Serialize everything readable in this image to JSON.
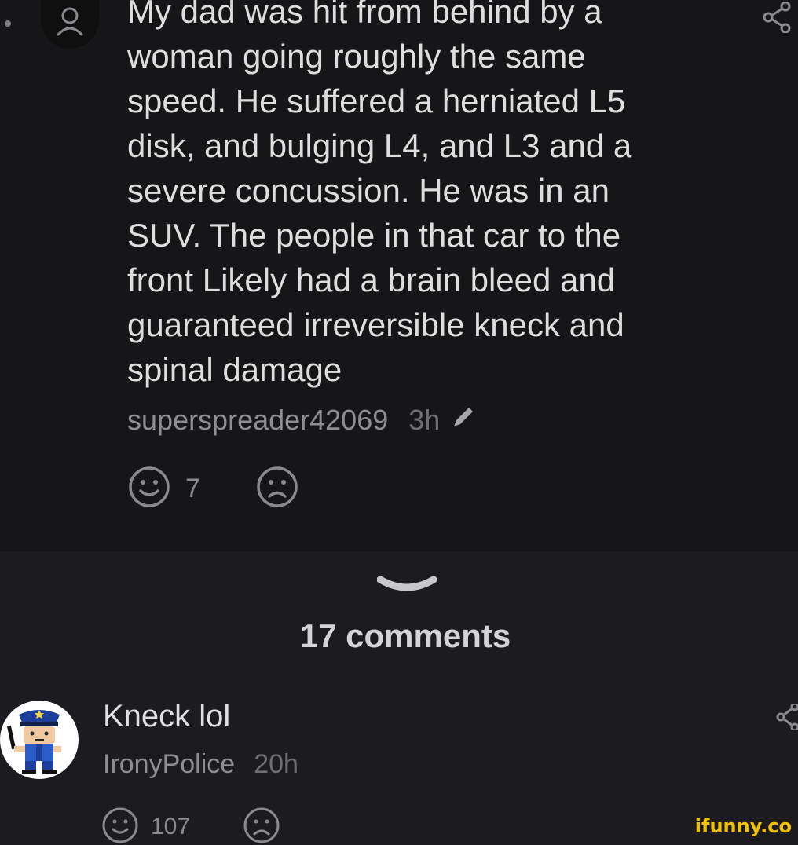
{
  "post": {
    "text": "My dad was hit from behind by a\nwoman going roughly the same\nspeed. He suffered a herniated L5\ndisk, and bulging L4, and L3 and a\nsevere concussion. He was in an\nSUV. The people in that car to the\nfront Likely had a brain bleed and\nguaranteed irreversible kneck and\nspinal damage",
    "username": "superspreader42069",
    "time": "3h",
    "smile_count": "7",
    "icons": [
      "user-icon",
      "share-icon",
      "pencil-icon",
      "smile-icon",
      "sad-icon"
    ]
  },
  "divider": {
    "comments_label": "17 comments",
    "icon": "chevron-down-icon"
  },
  "reply": {
    "text": "Kneck lol",
    "username": "IronyPolice",
    "time": "20h",
    "smile_count": "107",
    "icons": [
      "police-avatar",
      "share-icon",
      "smile-icon",
      "sad-icon"
    ]
  },
  "watermark": "ifunny.co",
  "colors": {
    "top_background": "#161618",
    "bottom_background": "#1c1c20",
    "text": "#dedede",
    "muted": "#8e8e92",
    "watermark": "#f2c200"
  }
}
